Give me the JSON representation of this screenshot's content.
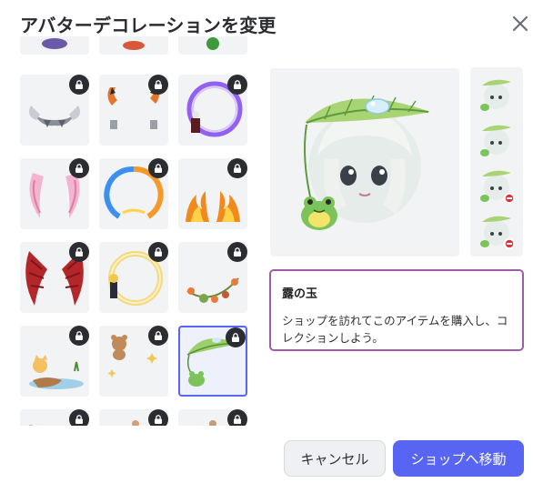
{
  "dialog": {
    "title": "アバターデコレーションを変更",
    "close_icon": "close-icon"
  },
  "decorations": [
    {
      "name": "viking-horns",
      "locked": true
    },
    {
      "name": "devil-horns",
      "locked": true
    },
    {
      "name": "dark-portal",
      "locked": true
    },
    {
      "name": "pink-ribbons",
      "locked": true
    },
    {
      "name": "fire-ice-ring",
      "locked": true
    },
    {
      "name": "flame-ears",
      "locked": true
    },
    {
      "name": "red-wings",
      "locked": true
    },
    {
      "name": "golden-halo",
      "locked": true
    },
    {
      "name": "vegetable-garland",
      "locked": true
    },
    {
      "name": "cat-fishing",
      "locked": true
    },
    {
      "name": "teddy-bear-sparkles",
      "locked": true
    },
    {
      "name": "leaf-frog",
      "locked": true,
      "selected": true
    },
    {
      "name": "item-13",
      "locked": true
    },
    {
      "name": "item-14",
      "locked": true
    },
    {
      "name": "item-15",
      "locked": true
    }
  ],
  "selected_item": {
    "name": "露の玉",
    "description": "ショップを訪れてこのアイテムを購入し、コレクションしよう。"
  },
  "buttons": {
    "cancel": "キャンセル",
    "go_to_shop": "ショップへ移動"
  },
  "colors": {
    "accent": "#5865f2",
    "info_border": "#9b5fa8",
    "lock_badge": "#2b2d31"
  }
}
